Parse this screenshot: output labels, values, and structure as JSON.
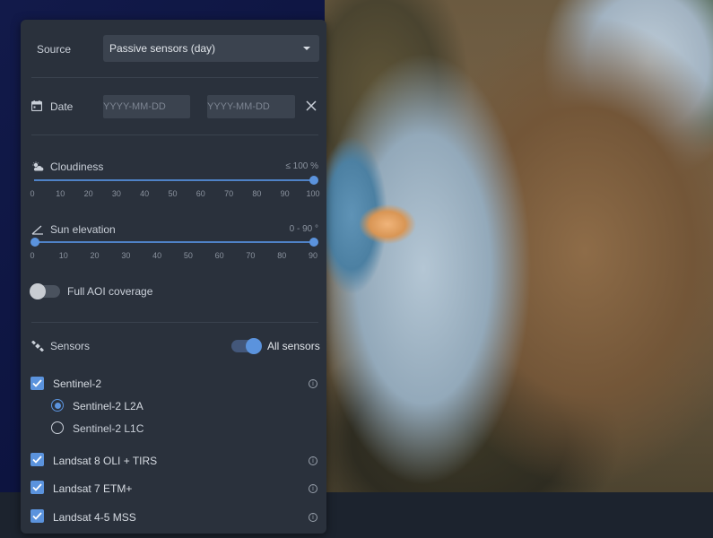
{
  "source": {
    "label": "Source",
    "selected": "Passive sensors (day)"
  },
  "date": {
    "label": "Date",
    "from_placeholder": "YYYY-MM-DD",
    "to_placeholder": "YYYY-MM-DD",
    "clear_icon": "close-icon"
  },
  "cloudiness": {
    "label": "Cloudiness",
    "value_text": "≤ 100 %",
    "value": 100,
    "ticks": [
      "0",
      "10",
      "20",
      "30",
      "40",
      "50",
      "60",
      "70",
      "80",
      "90",
      "100"
    ]
  },
  "sun_elevation": {
    "label": "Sun elevation",
    "value_text": "0 - 90 °",
    "min": 0,
    "max": 90,
    "ticks": [
      "0",
      "10",
      "20",
      "30",
      "40",
      "50",
      "60",
      "70",
      "80",
      "90"
    ]
  },
  "full_aoi": {
    "label": "Full AOI coverage",
    "enabled": false
  },
  "sensors": {
    "label": "Sensors",
    "all_label": "All sensors",
    "all_enabled": true,
    "items": [
      {
        "label": "Sentinel-2",
        "checked": true
      },
      {
        "label": "Landsat 8 OLI + TIRS",
        "checked": true
      },
      {
        "label": "Landsat 7 ETM+",
        "checked": true
      },
      {
        "label": "Landsat 4-5 MSS",
        "checked": true
      }
    ],
    "sentinel_levels": [
      {
        "label": "Sentinel-2 L2A",
        "selected": true
      },
      {
        "label": "Sentinel-2 L1C",
        "selected": false
      }
    ]
  },
  "colors": {
    "accent": "#5b93dd",
    "panel": "#2a313c",
    "input": "#3b434f"
  }
}
